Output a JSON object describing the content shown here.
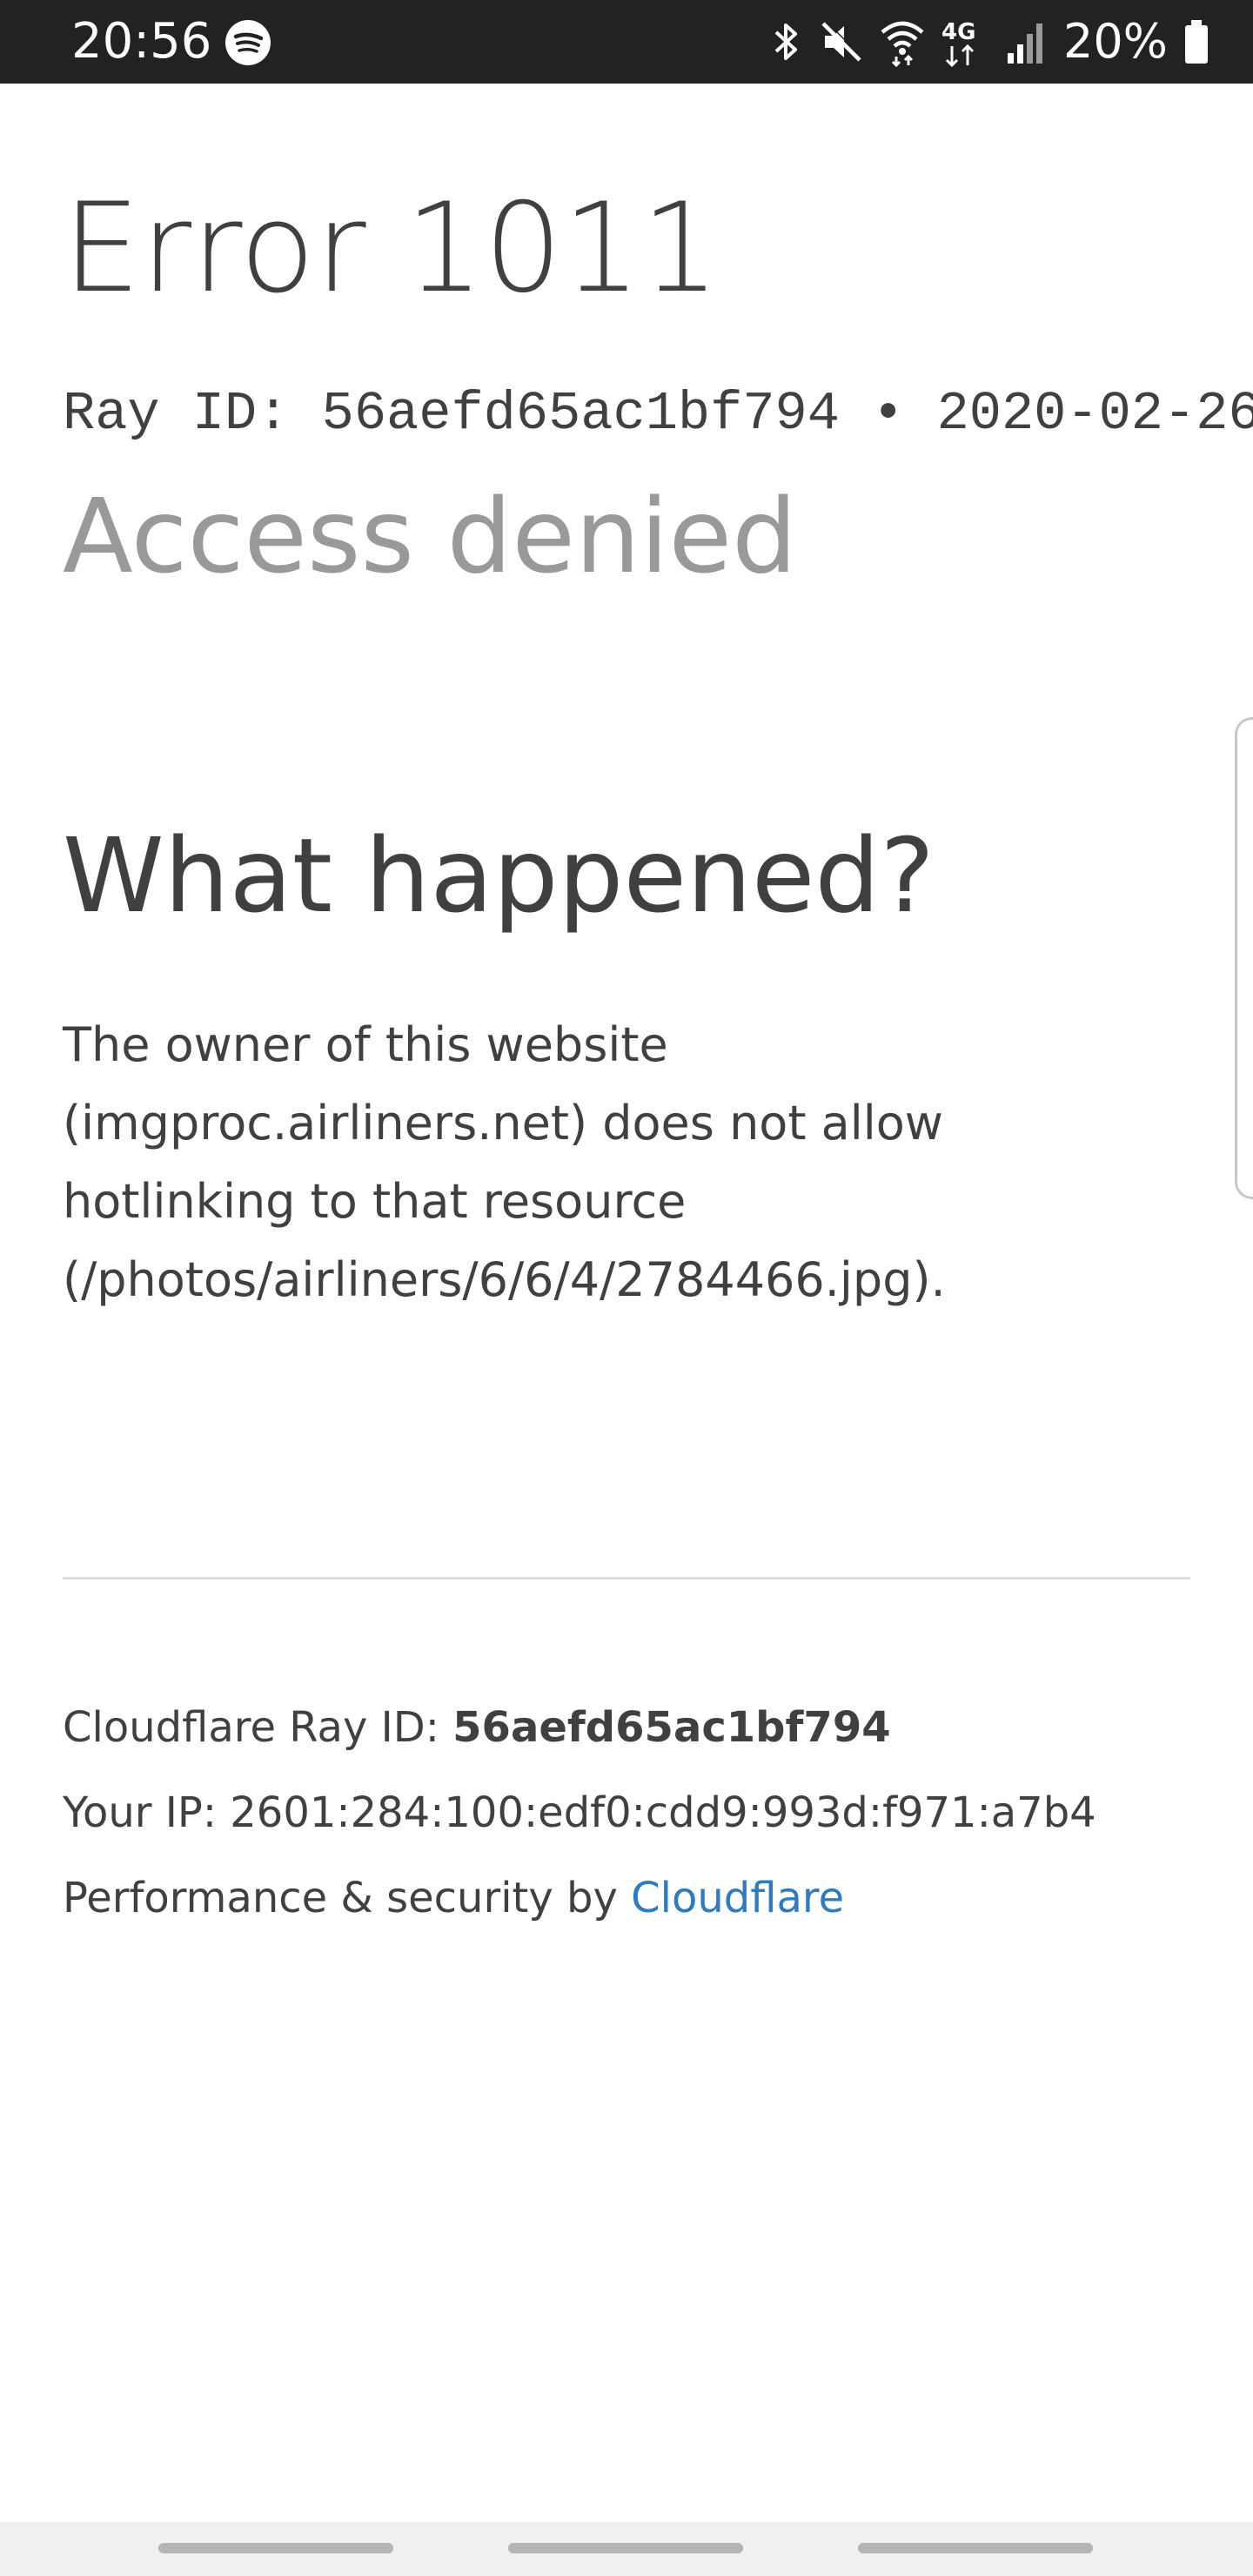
{
  "status_bar": {
    "time": "20:56",
    "battery_percent": "20%",
    "icons": [
      "spotify-icon",
      "bluetooth-icon",
      "mute-icon",
      "wifi-icon",
      "lte-icon",
      "signal-icon",
      "battery-icon"
    ],
    "network_label": "4G"
  },
  "page": {
    "error_title": "Error 1011",
    "ray_line": "Ray ID: 56aefd65ac1bf794 • 2020-02-26",
    "access_denied": "Access denied",
    "what_happened_heading": "What happened?",
    "explanation_lines": [
      "The owner of this website",
      "(imgproc.airliners.net) does not allow",
      "hotlinking to that resource",
      "(/photos/airliners/6/6/4/2784466.jpg)."
    ]
  },
  "footer": {
    "ray_id_label": "Cloudflare Ray ID: ",
    "ray_id_value": "56aefd65ac1bf794",
    "ip_line": "Your IP: 2601:284:100:edf0:cdd9:993d:f971:a7b4",
    "performance_label": "Performance & security by ",
    "cloudflare_link": "Cloudflare"
  },
  "colors": {
    "status_bar_bg": "#222222",
    "text": "#404040",
    "muted_heading": "#999999",
    "link": "#2f7bbf",
    "divider": "#dedede"
  }
}
